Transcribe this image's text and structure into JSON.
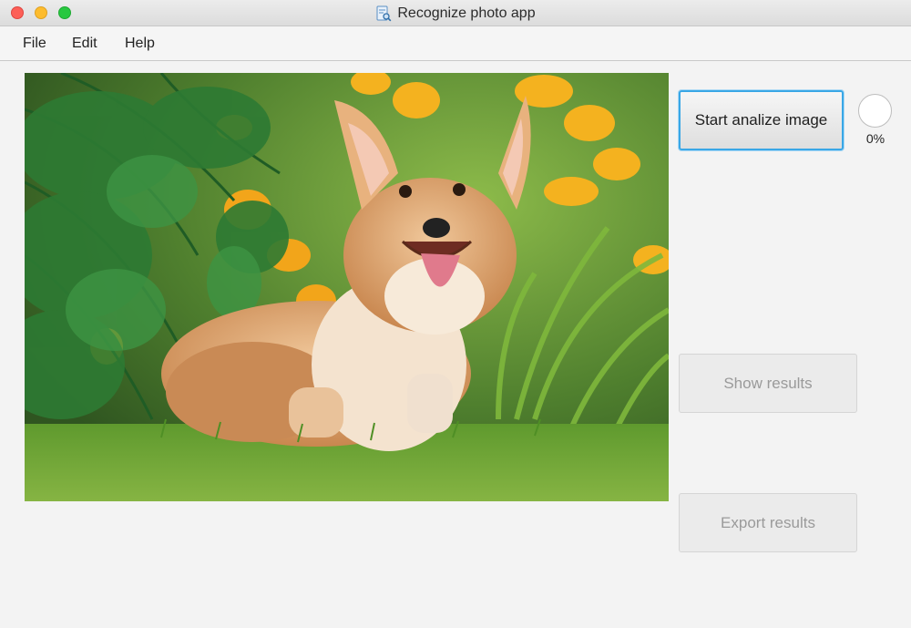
{
  "window": {
    "title": "Recognize photo app",
    "title_icon": "document-magnifier-icon",
    "controls": [
      "close",
      "minimize",
      "maximize"
    ]
  },
  "menu": {
    "file": "File",
    "edit": "Edit",
    "help": "Help"
  },
  "photo": {
    "alt": "corgi-dog-photo"
  },
  "buttons": {
    "start": "Start analize image",
    "show": "Show results",
    "export": "Export results"
  },
  "progress": {
    "value": 0,
    "label": "0%"
  },
  "colors": {
    "focus_border": "#39a7e6",
    "disabled_text": "#9a9a9a",
    "close": "#fd5f57",
    "minimize": "#fdbc2e",
    "maximize": "#28c840"
  }
}
